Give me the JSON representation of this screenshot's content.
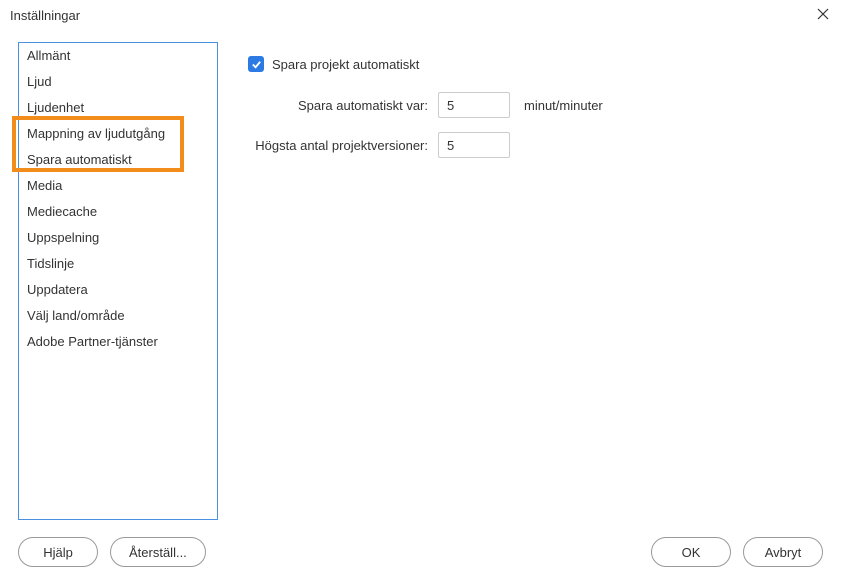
{
  "title": "Inställningar",
  "sidebar": {
    "items": [
      {
        "label": "Allmänt"
      },
      {
        "label": "Ljud"
      },
      {
        "label": "Ljudenhet"
      },
      {
        "label": "Mappning av ljudutgång"
      },
      {
        "label": "Spara automatiskt"
      },
      {
        "label": "Media"
      },
      {
        "label": "Mediecache"
      },
      {
        "label": "Uppspelning"
      },
      {
        "label": "Tidslinje"
      },
      {
        "label": "Uppdatera"
      },
      {
        "label": "Välj land/område"
      },
      {
        "label": "Adobe Partner-tjänster"
      }
    ]
  },
  "content": {
    "checkbox_label": "Spara projekt automatiskt",
    "checkbox_checked": true,
    "interval_label": "Spara automatiskt var:",
    "interval_value": "5",
    "interval_suffix": "minut/minuter",
    "versions_label": "Högsta antal projektversioner:",
    "versions_value": "5"
  },
  "footer": {
    "help": "Hjälp",
    "reset": "Återställ...",
    "ok": "OK",
    "cancel": "Avbryt"
  }
}
